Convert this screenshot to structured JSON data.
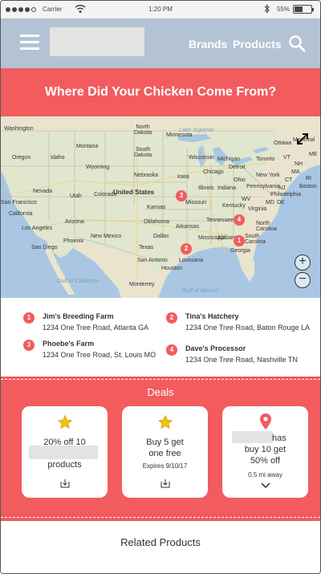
{
  "status_bar": {
    "carrier": "Carrier",
    "time": "1:20 PM",
    "battery": "55%"
  },
  "header": {
    "nav_brands": "Brands",
    "nav_products": "Products",
    "icons": [
      "menu-icon",
      "search-icon"
    ]
  },
  "title": "Where Did Your Chicken Come From?",
  "map": {
    "labels": {
      "north_dakota": "North\nDakota",
      "south_dakota": "South\nDakota",
      "nebraska": "Nebraska",
      "kansas": "Kansas",
      "oklahoma": "Oklahoma",
      "texas": "Texas",
      "washington": "Washington",
      "montana": "Montana",
      "idaho": "Idaho",
      "wyoming": "Wyoming",
      "oregon": "Oregon",
      "nevada": "Nevada",
      "utah": "Utah",
      "colorado": "Colorado",
      "california": "California",
      "arizona": "Arizona",
      "new_mexico": "New Mexico",
      "minnesota": "Minnesota",
      "iowa": "Iowa",
      "missouri": "Missouri",
      "arkansas": "Arkansas",
      "louisiana": "Louisiana",
      "mississippi": "Mississippi",
      "alabama": "Alabama",
      "georgia": "Georgia",
      "tennessee": "Tennessee",
      "kentucky": "Kentucky",
      "illinois": "Illinois",
      "indiana": "Indiana",
      "ohio": "Ohio",
      "michigan": "Michigan",
      "wisconsin": "Wisconsin",
      "chicago": "Chicago",
      "detroit": "Detroit",
      "toronto": "Toronto",
      "ottawa": "Ottawa",
      "montreal": "Montreal",
      "new_york": "New York",
      "pennsylvania": "Pennsylvania",
      "philadelphia": "Philadelphia",
      "virginia": "Virginia",
      "north_carolina": "North\nCarolina",
      "south_carolina": "South\nCarolina",
      "united_states": "United States",
      "san_francisco": "San Francisco",
      "los_angeles": "Los Angeles",
      "san_diego": "San Diego",
      "phoenix": "Phoenix",
      "dallas": "Dallas",
      "houston": "Houston",
      "san_antonio": "San Antonio",
      "monterrey": "Monterrey",
      "gulf_california": "Gulf of California",
      "gulf_mexico": "Gulf of Mexico",
      "lake_superior": "Lake Superior",
      "maine": "ME",
      "vermont": "VT",
      "new_hampshire": "NH",
      "massachusetts": "MA",
      "connecticut": "CT",
      "new_jersey": "NJ",
      "maryland": "MD",
      "delaware": "DE",
      "west_virginia": "WV",
      "rhode_island": "RI",
      "boston": "Boston"
    },
    "pins": [
      "1",
      "2",
      "3",
      "4"
    ]
  },
  "locations": [
    {
      "num": "1",
      "name": "Jim's Breeding Farm",
      "address": "1234 One Tree Road, Atlanta GA"
    },
    {
      "num": "2",
      "name": "Tina's Hatchery",
      "address": "1234 One Tree Road, Baton Rouge LA"
    },
    {
      "num": "3",
      "name": "Phoebe's Farm",
      "address": "1234 One Tree Road, St. Louis MO"
    },
    {
      "num": "4",
      "name": "Dave's Processor",
      "address": "1234 One Tree Road, Nashville TN"
    }
  ],
  "deals": {
    "title": "Deals",
    "cards": [
      {
        "line1": "20% off 10",
        "line3": "products",
        "icon": "star-icon",
        "action_icon": "download-icon"
      },
      {
        "line1": "Buy 5 get",
        "line2": "one free",
        "expires": "Expires 9/10/17",
        "icon": "star-icon",
        "action_icon": "download-icon"
      },
      {
        "line1": "has",
        "line2": "buy 10 get",
        "line3": "50% off",
        "distance": "0.5 mi away",
        "icon": "location-pin-icon",
        "action_icon": "chevron-down-icon"
      }
    ]
  },
  "related": {
    "title": "Related Products"
  },
  "colors": {
    "accent": "#f25c5e",
    "header": "#b4c3d4",
    "placeholder": "#e3e3e3"
  }
}
